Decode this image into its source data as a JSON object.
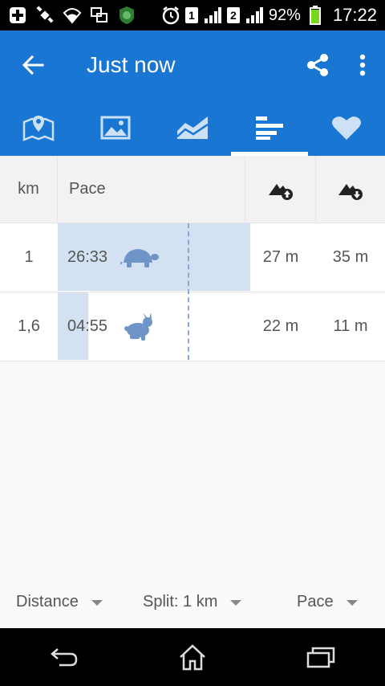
{
  "status_bar": {
    "battery": "92%",
    "time": "17:22",
    "sim1": "1",
    "sim2": "2"
  },
  "app_bar": {
    "title": "Just now"
  },
  "tabs": [
    {
      "name": "map",
      "icon": "map-pin-icon"
    },
    {
      "name": "photos",
      "icon": "image-icon"
    },
    {
      "name": "graph",
      "icon": "chart-area-icon"
    },
    {
      "name": "splits",
      "icon": "bars-icon",
      "active": true
    },
    {
      "name": "health",
      "icon": "heart-icon"
    }
  ],
  "table": {
    "headers": {
      "km": "km",
      "pace": "Pace",
      "ascent_icon": "ascent-icon",
      "descent_icon": "descent-icon"
    },
    "rows": [
      {
        "km": "1",
        "pace": "26:33",
        "pace_icon": "turtle-icon",
        "pace_fraction": 1.0,
        "ascent": "27 m",
        "descent": "35 m"
      },
      {
        "km": "1,6",
        "pace": "04:55",
        "pace_icon": "rabbit-icon",
        "pace_fraction": 0.16,
        "ascent": "22 m",
        "descent": "11 m"
      }
    ]
  },
  "bottom": {
    "distance_label": "Distance",
    "split_label": "Split: 1 km",
    "pace_label": "Pace"
  },
  "colors": {
    "primary": "#1976d2",
    "pace_bar": "#d3e1f2",
    "pace_icon": "#6f94c8"
  }
}
